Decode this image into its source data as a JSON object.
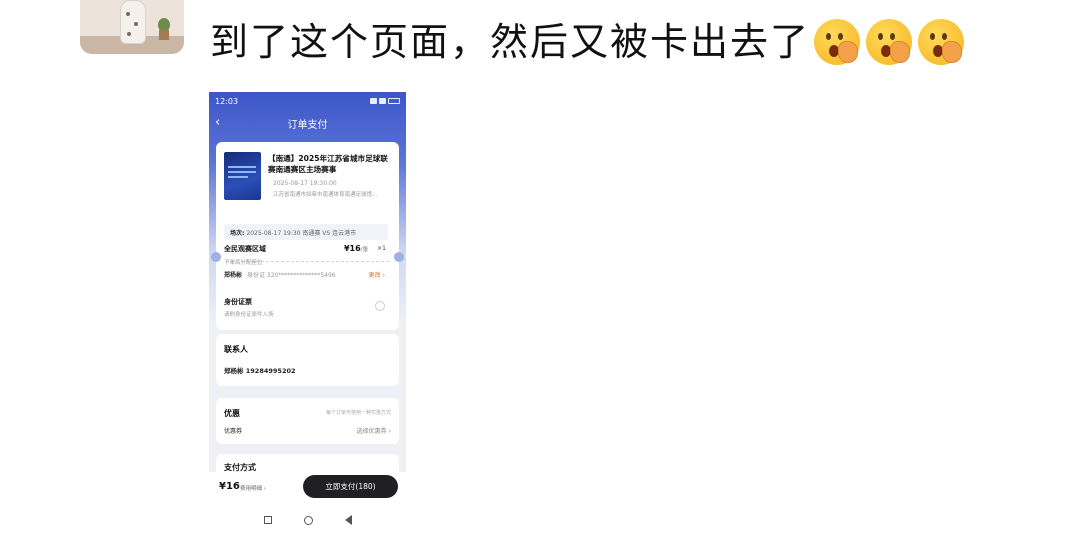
{
  "message": {
    "text": "到了这个页面，然后又被卡出去了",
    "emoji_count": 3,
    "emoji_icon": "face-with-hand-over-mouth"
  },
  "phone": {
    "status_time": "12:03",
    "nav_title": "订单支付",
    "event": {
      "title": "【南通】2025年江苏省城市足球联赛南通赛区主场赛事",
      "datetime": "2025-08-17 19:30:00",
      "venue": "江苏省南通市如皋市南通体育南通足球馆..."
    },
    "session": {
      "label": "场次:",
      "value": "2025-08-17 19:30 南通赛 VS 连云港市"
    },
    "area": {
      "name": "全民观赛区域",
      "price": "¥16",
      "price_unit": "/张",
      "count": "×1",
      "sub": "下单后分配座位"
    },
    "person": {
      "name": "郑杨彬",
      "id_label": "身份证",
      "id_masked": "320**************5496",
      "change": "更改"
    },
    "id_ticket": {
      "title": "身份证票",
      "sub": "请刷身份证原件入场"
    },
    "contact": {
      "title": "联系人",
      "value": "郑杨彬 19284995202"
    },
    "promo": {
      "title": "优惠",
      "note": "每个订单可使用一种优惠方式",
      "coupon_label": "优惠券",
      "coupon_value": "选择优惠券"
    },
    "payment": {
      "title": "支付方式"
    },
    "bottom": {
      "total": "¥16",
      "detail_link": "费用明细",
      "pay_button": "立即支付(180)"
    }
  }
}
